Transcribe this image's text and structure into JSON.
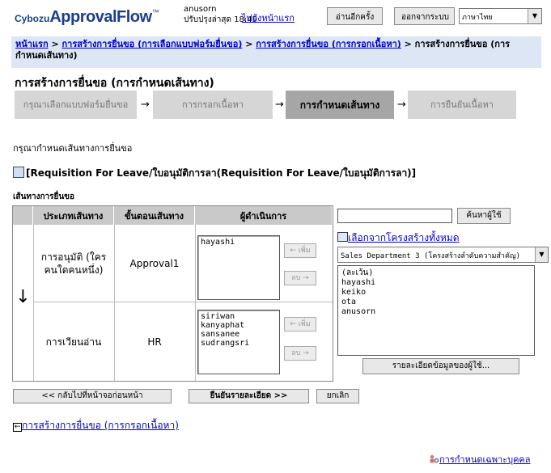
{
  "header": {
    "logo_brand": "Cybozu",
    "logo_product": "ApprovalFlow",
    "logo_tm": "™",
    "user_name": "anusorn",
    "updated_text": "ปรับปรุงล่าสุด 18:49",
    "home_link": "ไปยังหน้าแรก",
    "reread_button": "อ่านอีกครั้ง",
    "logout_button": "ออกจากระบบ",
    "language_value": "ภาษาไทย"
  },
  "breadcrumb": {
    "item1": "หน้าแรก",
    "sep": " > ",
    "item2": "การสร้างการยื่นขอ (การเลือกแบบฟอร์มยื่นขอ)",
    "item3": "การสร้างการยื่นขอ (การกรอกเนื้อหา)",
    "current": "การสร้างการยื่นขอ (การกำหนดเส้นทาง)"
  },
  "page_title": "การสร้างการยื่นขอ (การกำหนดเส้นทาง)",
  "steps": [
    {
      "label": "กรุณาเลือกแบบฟอร์มยื่นขอ"
    },
    {
      "label": "การกรอกเนื้อหา"
    },
    {
      "label": "การกำหนดเส้นทาง"
    },
    {
      "label": "การยืนยันเนื้อหา"
    }
  ],
  "step_arrow": "→",
  "instruction": "กรุณากำหนดเส้นทางการยื่นขอ",
  "form_name": "[Requisition For Leave/ใบอนุมัติการลา(Requisition For Leave/ใบอนุมัติการลา)]",
  "route_section_label": "เส้นทางการยื่นขอ",
  "route_table": {
    "headers": {
      "type": "ประเภทเส้นทาง",
      "step": "ขั้นตอนเส้นทาง",
      "operator": "ผู้ดำเนินการ"
    },
    "flow_arrow": "↓",
    "rows": [
      {
        "type": "การอนุมัติ (ใครคนใดคนหนึ่ง)",
        "step": "Approval1",
        "users": [
          "hayashi"
        ]
      },
      {
        "type": "การเวียนอ่าน",
        "step": "HR",
        "users": [
          "siriwan",
          "kanyaphat",
          "sansanee",
          "sudrangsri"
        ]
      }
    ],
    "add_button": "← เพิ่ม",
    "remove_button": "ลบ →"
  },
  "user_picker": {
    "search_value": "",
    "search_button": "ค้นหาผู้ใช้",
    "org_link": "เลือกจากโครงสร้างทั้งหมด",
    "org_select_value": "Sales Department 3 (โครงสร้างลำดับความสำคัญ)",
    "users": [
      "(ละเว้น)",
      "hayashi",
      "keiko",
      "ota",
      "anusorn"
    ],
    "detail_button": "รายละเอียดข้อมูลของผู้ใช้..."
  },
  "buttons": {
    "back": "<< กลับไปที่หน้าจอก่อนหน้า",
    "confirm": "ยืนยันรายละเอียด >>",
    "cancel": "ยกเลิก"
  },
  "back_link": "การสร้างการยื่นขอ (การกรอกเนื้อหา)",
  "personal_settings_link": "การกำหนดเฉพาะบุคคล"
}
